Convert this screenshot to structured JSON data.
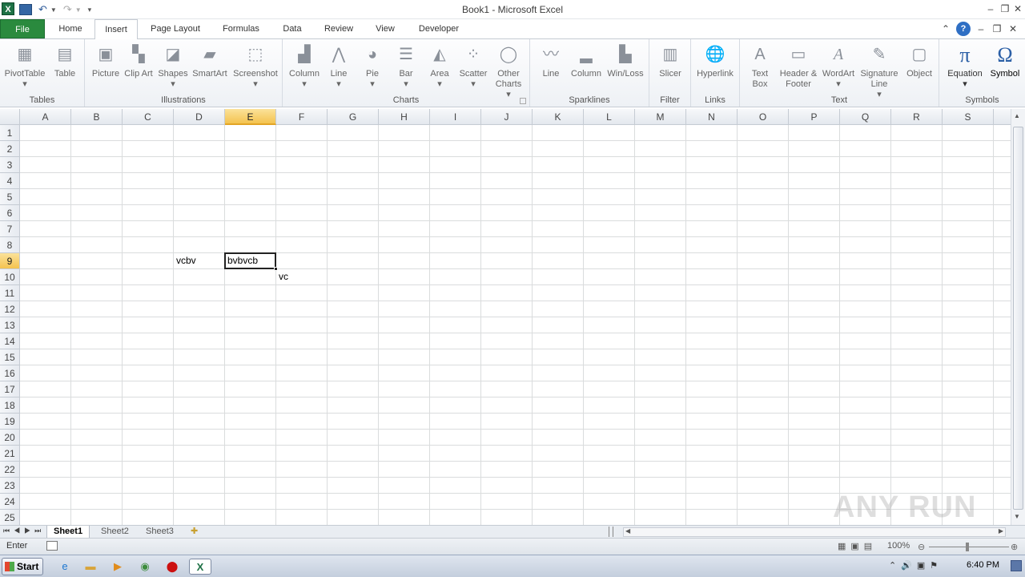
{
  "window": {
    "title": "Book1 - Microsoft Excel",
    "app_icon": "X"
  },
  "quick_access": {
    "save_icon": "save-icon",
    "undo_icon": "undo-icon",
    "redo_icon": "redo-icon"
  },
  "tabs": [
    {
      "label": "File"
    },
    {
      "label": "Home"
    },
    {
      "label": "Insert"
    },
    {
      "label": "Page Layout"
    },
    {
      "label": "Formulas"
    },
    {
      "label": "Data"
    },
    {
      "label": "Review"
    },
    {
      "label": "View"
    },
    {
      "label": "Developer"
    }
  ],
  "active_tab": "Insert",
  "ribbon": {
    "groups": [
      {
        "label": "Tables",
        "buttons": [
          {
            "label": "PivotTable"
          },
          {
            "label": "Table"
          }
        ]
      },
      {
        "label": "Illustrations",
        "buttons": [
          {
            "label": "Picture"
          },
          {
            "label": "Clip Art"
          },
          {
            "label": "Shapes"
          },
          {
            "label": "SmartArt"
          },
          {
            "label": "Screenshot"
          }
        ]
      },
      {
        "label": "Charts",
        "buttons": [
          {
            "label": "Column"
          },
          {
            "label": "Line"
          },
          {
            "label": "Pie"
          },
          {
            "label": "Bar"
          },
          {
            "label": "Area"
          },
          {
            "label": "Scatter"
          },
          {
            "label": "Other Charts"
          }
        ]
      },
      {
        "label": "Sparklines",
        "buttons": [
          {
            "label": "Line"
          },
          {
            "label": "Column"
          },
          {
            "label": "Win/Loss"
          }
        ]
      },
      {
        "label": "Filter",
        "buttons": [
          {
            "label": "Slicer"
          }
        ]
      },
      {
        "label": "Links",
        "buttons": [
          {
            "label": "Hyperlink"
          }
        ]
      },
      {
        "label": "Text",
        "buttons": [
          {
            "label": "Text Box"
          },
          {
            "label": "Header & Footer"
          },
          {
            "label": "WordArt"
          },
          {
            "label": "Signature Line"
          },
          {
            "label": "Object"
          }
        ]
      },
      {
        "label": "Symbols",
        "buttons": [
          {
            "label": "Equation"
          },
          {
            "label": "Symbol"
          }
        ]
      }
    ]
  },
  "grid": {
    "columns": [
      "A",
      "B",
      "C",
      "D",
      "E",
      "F",
      "G",
      "H",
      "I",
      "J",
      "K",
      "L",
      "M",
      "N",
      "O",
      "P",
      "Q",
      "R",
      "S"
    ],
    "rows": [
      "1",
      "2",
      "3",
      "4",
      "5",
      "6",
      "7",
      "8",
      "9",
      "10",
      "11",
      "12",
      "13",
      "14",
      "15",
      "16",
      "17",
      "18",
      "19",
      "20",
      "21",
      "22",
      "23",
      "24",
      "25"
    ],
    "selected_column": "E",
    "selected_row": "9",
    "cells": {
      "D9": "vcbv",
      "E9": "bvbvcb",
      "F10": "vc"
    }
  },
  "sheets": [
    {
      "label": "Sheet1"
    },
    {
      "label": "Sheet2"
    },
    {
      "label": "Sheet3"
    }
  ],
  "active_sheet": "Sheet1",
  "status": {
    "mode": "Enter",
    "zoom": "100%"
  },
  "taskbar": {
    "start_label": "Start",
    "clock": "6:40 PM"
  },
  "watermark": "ANY RUN"
}
